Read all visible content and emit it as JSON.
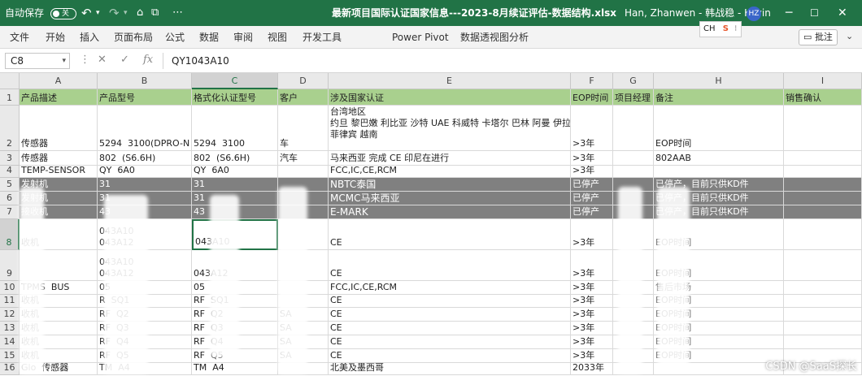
{
  "titlebar": {
    "autosave_label": "自动保存",
    "autosave_state": "关",
    "file_title": "最新项目国际认证国家信息---2023-8月续证评估-数据结构.xlsx",
    "user_name": "Han, Zhanwen - 韩战稳 - Kevin",
    "user_initials": "HZ"
  },
  "ribbon": {
    "tabs": [
      "文件",
      "开始",
      "插入",
      "页面布局",
      "公式",
      "数据",
      "审阅",
      "视图",
      "开发工具",
      "Power Pivot",
      "数据透视图分析"
    ],
    "comment_button": "批注",
    "ime_label": "CH",
    "ime_logo": "S"
  },
  "formula_bar": {
    "name_box": "C8",
    "formula": "QY1043A10",
    "fx": "fx"
  },
  "grid": {
    "columns": [
      "A",
      "B",
      "C",
      "D",
      "E",
      "F",
      "G",
      "H",
      "I"
    ],
    "selected_column": "C",
    "selected_row": "8",
    "rows": [
      {
        "num": "1",
        "style": "hdr",
        "cells": [
          "产品描述",
          "产品型号",
          "格式化认证型号",
          "客户",
          "涉及国家认证",
          "EOP时间",
          "项目经理",
          "备注",
          "销售确认"
        ]
      },
      {
        "num": "2",
        "style": "",
        "cells": [
          "传感器",
          "5294  3100(DPRO-N",
          "5294  3100",
          "车",
          "台湾地区\n约旦 黎巴嫩 利比亚 沙特 UAE 科威特 卡塔尔 巴林 阿曼 伊拉克\n菲律宾 越南",
          ">3年",
          "",
          "EOP时间",
          ""
        ]
      },
      {
        "num": "3",
        "style": "",
        "cells": [
          "传感器",
          "802  (S6.6H)",
          "802  (S6.6H)",
          "汽车",
          "马来西亚 完成 CE 印尼在进行",
          ">3年",
          "",
          "802AAB",
          ""
        ]
      },
      {
        "num": "4",
        "style": "",
        "cells": [
          "TEMP-SENSOR",
          "QY  6A0",
          "QY  6A0",
          "",
          "FCC,IC,CE,RCM",
          ">3年",
          "",
          "",
          ""
        ]
      },
      {
        "num": "5",
        "style": "gray",
        "cells": [
          "发射机",
          "31",
          "31",
          "",
          "NBTC泰国",
          "已停产",
          "",
          "已停产，目前只供KD件",
          ""
        ]
      },
      {
        "num": "6",
        "style": "gray",
        "cells": [
          "发射机",
          "31",
          "31",
          "",
          "MCMC马来西亚",
          "已停产",
          "",
          "已停产，目前只供KD件",
          ""
        ]
      },
      {
        "num": "7",
        "style": "gray",
        "cells": [
          "接收机",
          "43",
          "43",
          "",
          "E-MARK",
          "已停产",
          "",
          "已停产，目前只供KD件",
          ""
        ]
      },
      {
        "num": "8",
        "style": "",
        "cells": [
          "收机",
          "043A10\n043A12",
          "043A10",
          "",
          "CE",
          ">3年",
          "",
          "EOP时间",
          ""
        ]
      },
      {
        "num": "9",
        "style": "",
        "cells": [
          "",
          "043A10\n043A12",
          "043A12",
          "",
          "CE",
          ">3年",
          "",
          "EOP时间",
          ""
        ]
      },
      {
        "num": "10",
        "style": "",
        "cells": [
          "TPMS  BUS",
          "05",
          "05",
          "",
          "FCC,IC,CE,RCM",
          ">3年",
          "",
          "售后市场",
          ""
        ]
      },
      {
        "num": "11",
        "style": "",
        "cells": [
          "收机",
          "R  SQ1",
          "RF  SQ1",
          "",
          "CE",
          ">3年",
          "",
          "EOP时间",
          ""
        ]
      },
      {
        "num": "12",
        "style": "",
        "cells": [
          "收机",
          "RF  Q2",
          "RF  Q2",
          "SA",
          "CE",
          ">3年",
          "",
          "EOP时间",
          ""
        ]
      },
      {
        "num": "13",
        "style": "",
        "cells": [
          "收机",
          "RF  Q3",
          "RF  Q3",
          "SA",
          "CE",
          ">3年",
          "",
          "EOP时间",
          ""
        ]
      },
      {
        "num": "14",
        "style": "",
        "cells": [
          "收机",
          "RF  Q4",
          "RF  Q4",
          "SA",
          "CE",
          ">3年",
          "",
          "EOP时间",
          ""
        ]
      },
      {
        "num": "15",
        "style": "",
        "cells": [
          "收机",
          "RF  Q5",
          "RF  Q5",
          "SA",
          "CE",
          ">3年",
          "",
          "EOP时间",
          ""
        ]
      },
      {
        "num": "16",
        "style": "",
        "cells": [
          "Glo  传感器",
          "TM  A4",
          "TM  A4",
          "",
          "北美及墨西哥",
          "2033年",
          "",
          "",
          ""
        ]
      }
    ]
  },
  "watermark": "CSDN @SaaS探长"
}
